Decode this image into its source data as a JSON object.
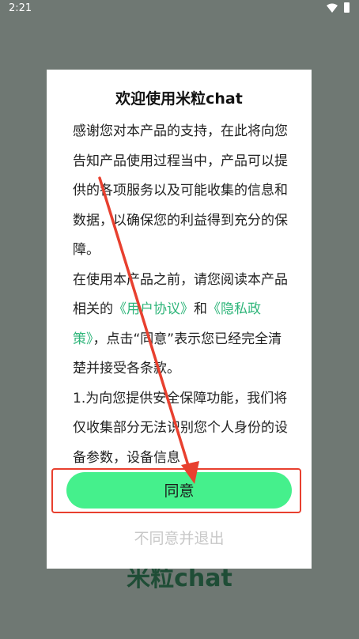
{
  "status_bar": {
    "time": "2:21"
  },
  "background": {
    "brand": "米粒chat"
  },
  "dialog": {
    "title": "欢迎使用米粒chat",
    "para1": "感谢您对本产品的支持，在此将向您告知产品使用过程当中，产品可以提供的各项服务以及可能收集的信息和数据，以确保您的利益得到充分的保障。",
    "para2_prefix": "在使用本产品之前，请您阅读本产品相关的",
    "user_agreement_link": "《用户协议》",
    "para2_and": "和",
    "privacy_policy_link": "《隐私政策》",
    "para2_suffix": "，点击“同意”表示您已经完全清楚并接受各条款。",
    "para3": "1.为向您提供安全保障功能，我们将仅收集部分无法识别您个人身份的设备参数，设备信息",
    "agree_label": "同意",
    "decline_label": "不同意并退出"
  },
  "colors": {
    "agree_button": "#45f08c",
    "link": "#2fb57a",
    "annotation": "#e8402f"
  }
}
